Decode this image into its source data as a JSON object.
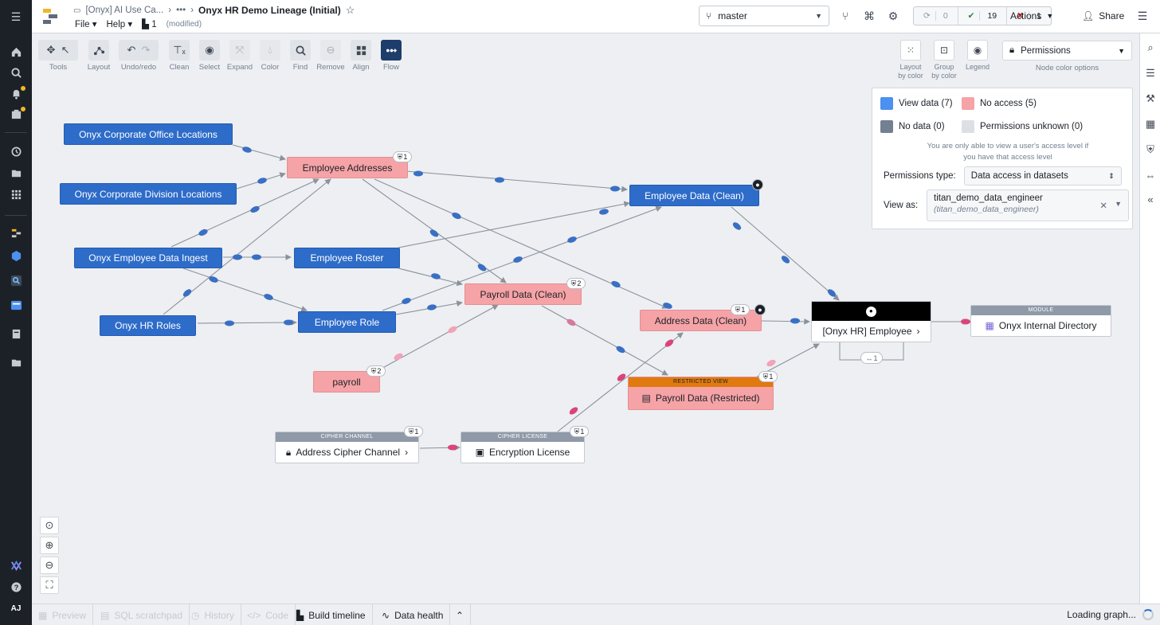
{
  "header": {
    "crumb_parent": "[Onyx] AI Use Ca...",
    "crumb_more": "•••",
    "title": "Onyx HR Demo Lineage (Initial)",
    "menu_file": "File",
    "menu_help": "Help",
    "count": "1",
    "modified": "(modified)",
    "branch": "master",
    "checks_running": "0",
    "checks_pass": "19",
    "checks_fail": "1",
    "actions": "Actions",
    "share": "Share"
  },
  "toolbar": {
    "tools": "Tools",
    "layout": "Layout",
    "undo_redo": "Undo/redo",
    "clean": "Clean",
    "select": "Select",
    "expand": "Expand",
    "color": "Color",
    "find": "Find",
    "remove": "Remove",
    "align": "Align",
    "flow": "Flow"
  },
  "right_toolbar": {
    "layout_by_color_1": "Layout",
    "layout_by_color_2": "by color",
    "group_by_color_1": "Group",
    "group_by_color_2": "by color",
    "legend": "Legend",
    "color_option": "Permissions",
    "color_options_label": "Node color options"
  },
  "legend": {
    "view_data": "View data (7)",
    "no_access": "No access (5)",
    "no_data": "No data (0)",
    "unknown": "Permissions unknown (0)",
    "note_1": "You are only able to view a user's access level if",
    "note_2": "you have that access level",
    "perm_type_label": "Permissions type:",
    "perm_type_value": "Data access in datasets",
    "view_as_label": "View as:",
    "view_as_user": "titan_demo_data_engineer",
    "view_as_sub": "(titan_demo_data_engineer)",
    "colors": {
      "view": "#2e6cc9",
      "no_access": "#f5a3a6",
      "no_data": "#8f99a8",
      "unknown": "#dce0e5"
    }
  },
  "nodes": {
    "corp_office": "Onyx Corporate Office Locations",
    "corp_division": "Onyx Corporate Division Locations",
    "emp_ingest": "Onyx Employee Data Ingest",
    "hr_roles": "Onyx HR Roles",
    "emp_addresses": "Employee Addresses",
    "emp_addresses_badge": "1",
    "emp_roster": "Employee Roster",
    "emp_role": "Employee Role",
    "payroll_clean": "Payroll Data (Clean)",
    "payroll_clean_badge": "2",
    "payroll": "payroll",
    "payroll_badge": "2",
    "emp_data_clean": "Employee Data (Clean)",
    "address_clean": "Address Data (Clean)",
    "address_clean_badge": "1",
    "restricted_header": "RESTRICTED VIEW",
    "restricted": "Payroll Data (Restricted)",
    "restricted_badge": "1",
    "cipher_channel_header": "CIPHER CHANNEL",
    "cipher_channel": "Address Cipher Channel",
    "cipher_channel_badge": "1",
    "cipher_license_header": "CIPHER LICENSE",
    "cipher_license": "Encryption License",
    "cipher_license_badge": "1",
    "hr_employee": "[Onyx HR] Employee",
    "hr_employee_links": "1",
    "module_header": "MODULE",
    "module": "Onyx Internal Directory"
  },
  "bottom": {
    "preview": "Preview",
    "sql_scratchpad": "SQL scratchpad",
    "history": "History",
    "code": "Code",
    "build_timeline": "Build timeline",
    "data_health": "Data health",
    "status": "Loading graph..."
  },
  "user_initials": "AJ"
}
